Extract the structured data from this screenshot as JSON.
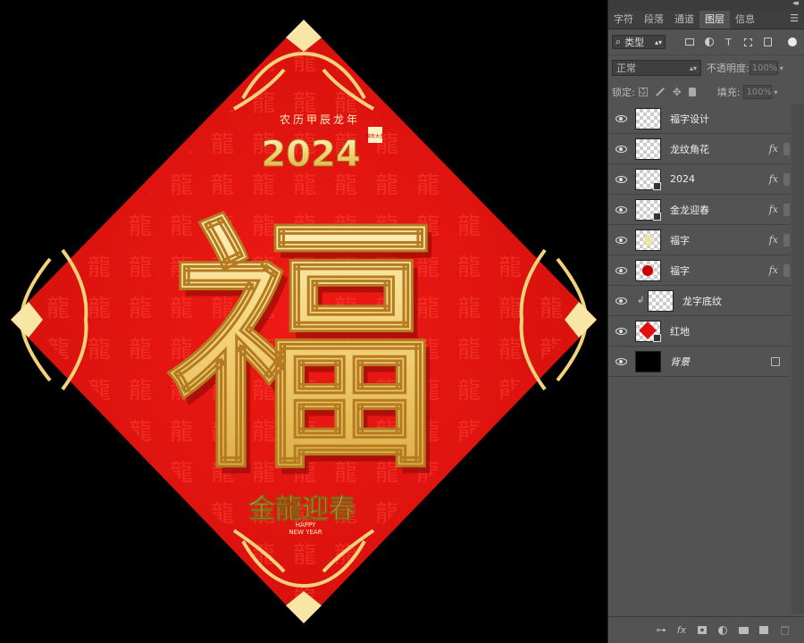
{
  "artwork": {
    "top_text": "农历甲辰龙年",
    "year": "2024",
    "year_badge": "龍年大吉",
    "main_char": "福",
    "title_calligraphy": "金龍迎春",
    "subtitle_en_1": "HAPPY",
    "subtitle_en_2": "NEW YEAR",
    "pattern_char": "龍",
    "colors": {
      "red": "#e3120f",
      "dark_red": "#b80b0b",
      "gold": "#f2d27a",
      "light_gold": "#fff6c8"
    }
  },
  "panel": {
    "collapse": "◂◂",
    "menu": "☰",
    "tabs": [
      "字符",
      "段落",
      "通道",
      "图层",
      "信息"
    ],
    "active_tab": 3,
    "filter_kind": "类型",
    "filter_icons": [
      "image-filter-icon",
      "adjustment-filter-icon",
      "text-filter-icon",
      "shape-filter-icon",
      "smart-object-filter-icon"
    ],
    "text_icon_glyph": "T",
    "blend_mode": "正常",
    "opacity_label": "不透明度:",
    "opacity_value": "100%",
    "lock_label": "锁定:",
    "fill_label": "填充:",
    "fill_value": "100%",
    "fx_label": "fx",
    "layers": [
      {
        "name": "福字设计",
        "thumb": "transparent",
        "fx": false
      },
      {
        "name": "龙纹角花",
        "thumb": "transparent",
        "fx": true
      },
      {
        "name": "2024",
        "thumb": "transparent-smart",
        "fx": true
      },
      {
        "name": "金龙迎春",
        "thumb": "transparent-smart",
        "fx": true
      },
      {
        "name": "福字",
        "thumb": "gold",
        "fx": true
      },
      {
        "name": "福字",
        "thumb": "red-fu",
        "fx": true
      },
      {
        "name": "龙字底纹",
        "thumb": "transparent",
        "fx": false,
        "clipped": true
      },
      {
        "name": "红地",
        "thumb": "red-diamond",
        "fx": false
      },
      {
        "name": "背景",
        "thumb": "black",
        "fx": false,
        "locked": true
      }
    ],
    "bottom_icons": [
      "link-layers-icon",
      "fx-icon",
      "add-mask-icon",
      "new-adjustment-icon",
      "new-group-icon",
      "new-layer-icon",
      "delete-layer-icon"
    ]
  }
}
